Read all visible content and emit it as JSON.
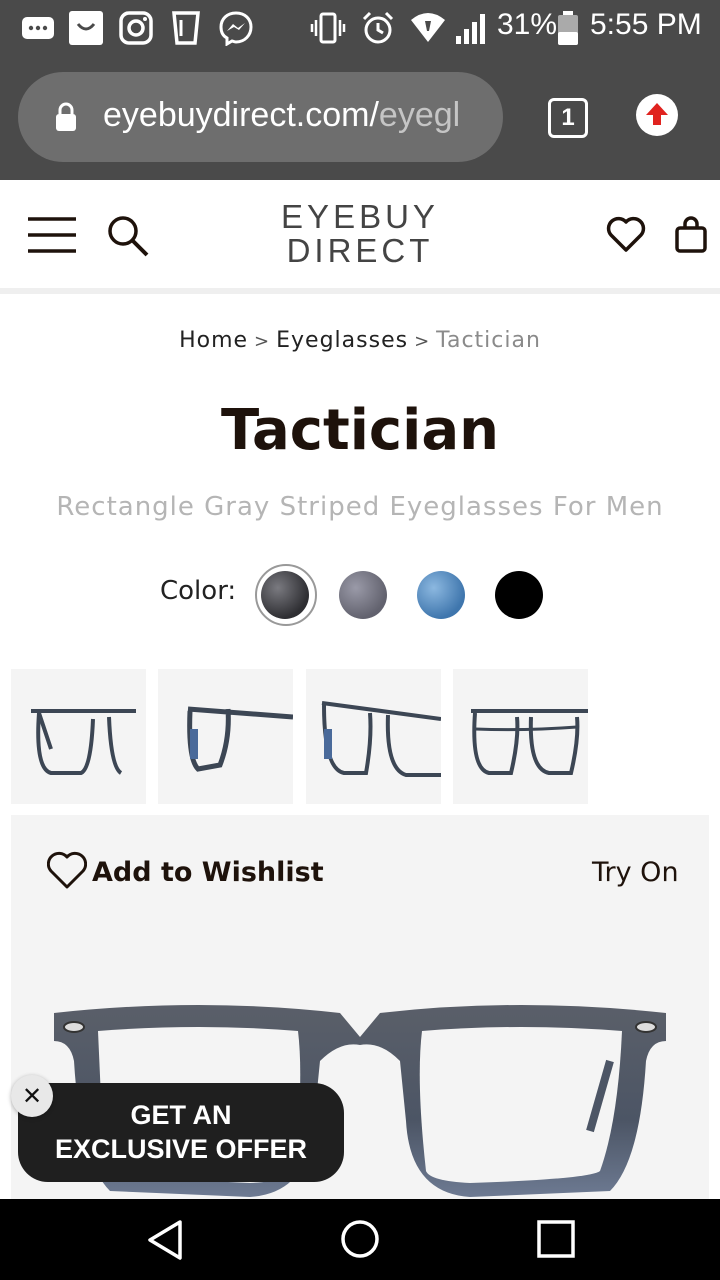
{
  "status_bar": {
    "battery": "31%",
    "time": "5:55 PM"
  },
  "browser": {
    "url_main": "eyebuydirect.com/",
    "url_fade": "eyegl",
    "tab_count": "1"
  },
  "header": {
    "logo_line1": "EYEBUY",
    "logo_line2": "DIRECT"
  },
  "breadcrumb": {
    "home": "Home",
    "sep": ">",
    "category": "Eyeglasses",
    "current": "Tactician"
  },
  "product": {
    "title": "Tactician",
    "subtitle": "Rectangle Gray Striped Eyeglasses For Men",
    "color_label": "Color:",
    "colors": [
      {
        "hex": "#3a3a3e"
      },
      {
        "hex": "#6a6a78"
      },
      {
        "hex": "#5a8fc4"
      },
      {
        "hex": "#000000"
      }
    ]
  },
  "actions": {
    "wishlist": "Add to Wishlist",
    "try_on": "Try On"
  },
  "promo": {
    "line1": "GET AN",
    "line2": "EXCLUSIVE OFFER",
    "close": "✕"
  }
}
